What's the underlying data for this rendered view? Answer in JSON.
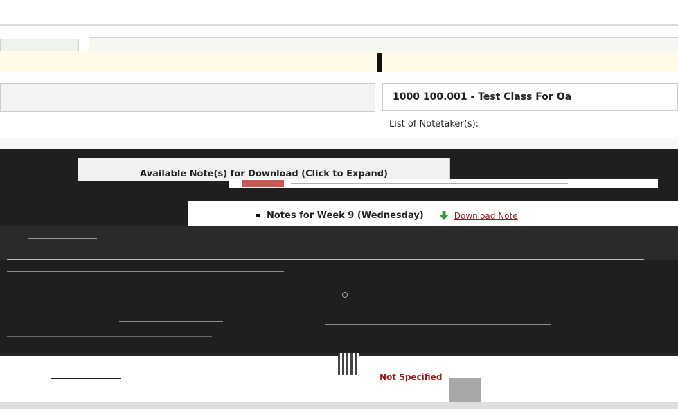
{
  "course": {
    "title": "1000 100.001 - Test Class For Oa"
  },
  "notetakers": {
    "label": "List of Notetaker(s):"
  },
  "notes_panel": {
    "expand_label": "Available Note(s) for Download (Click to Expand)",
    "items": [
      {
        "title": "Notes for Week 9 (Wednesday)",
        "download_label": "Download Note"
      }
    ]
  },
  "status": {
    "label": "Not Specified"
  },
  "colors": {
    "link_red": "#9b1c1c",
    "download_green": "#2e9d3a"
  }
}
